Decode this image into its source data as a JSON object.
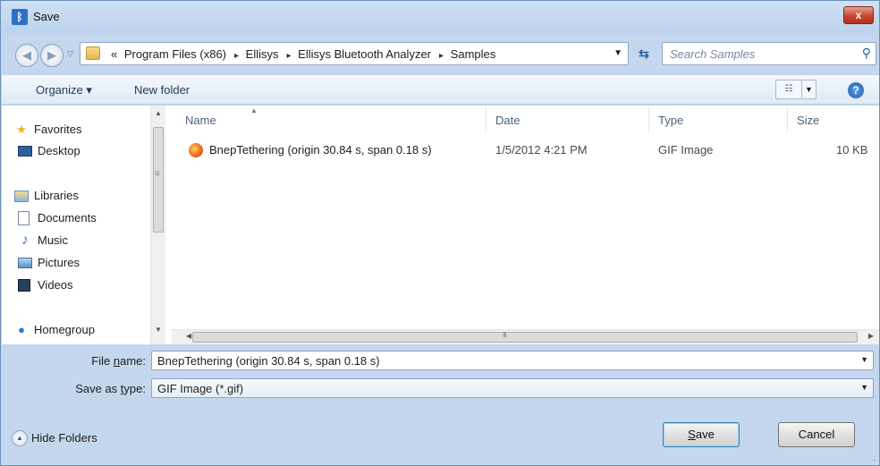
{
  "window": {
    "title": "Save",
    "close_label": "x"
  },
  "address_bar": {
    "prefix": "«",
    "crumbs": [
      "Program Files (x86)",
      "Ellisys",
      "Ellisys Bluetooth Analyzer",
      "Samples"
    ],
    "separator": "▸"
  },
  "search": {
    "placeholder": "Search Samples"
  },
  "toolbar": {
    "organize_label": "Organize ▾",
    "new_folder_label": "New folder"
  },
  "nav_pane": {
    "favorites": {
      "label": "Favorites",
      "items": [
        "Desktop"
      ]
    },
    "libraries": {
      "label": "Libraries",
      "items": [
        "Documents",
        "Music",
        "Pictures",
        "Videos"
      ]
    },
    "homegroup": {
      "label": "Homegroup"
    }
  },
  "file_list": {
    "columns": [
      "Name",
      "Date",
      "Type",
      "Size"
    ],
    "rows": [
      {
        "name": "BnepTethering (origin 30.84 s, span 0.18 s)",
        "date": "1/5/2012 4:21 PM",
        "type": "GIF Image",
        "size": "10 KB"
      }
    ]
  },
  "form": {
    "file_name_label_pre": "File ",
    "file_name_label_u": "n",
    "file_name_label_post": "ame:",
    "file_name_value": "BnepTethering (origin 30.84 s, span 0.18 s)",
    "save_type_label_pre": "Save as ",
    "save_type_label_u": "t",
    "save_type_label_post": "ype:",
    "save_type_value": "GIF Image (*.gif)"
  },
  "footer": {
    "hide_folders_label": "Hide Folders",
    "save_label_u": "S",
    "save_label_rest": "ave",
    "cancel_label": "Cancel"
  },
  "colors": {
    "chrome": "#c4d7ee",
    "close_button": "#c7452e",
    "link_text": "#1e395b"
  }
}
